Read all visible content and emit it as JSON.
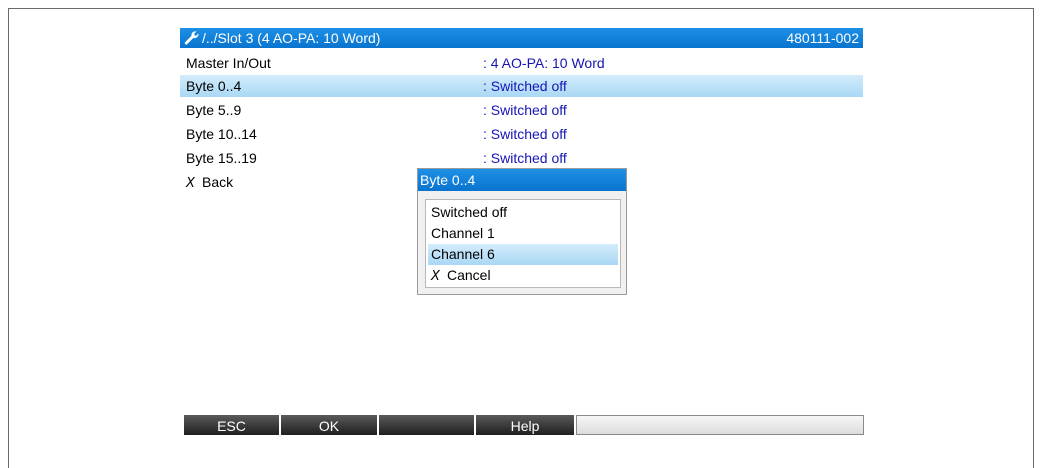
{
  "header": {
    "path": "/../Slot 3 (4 AO-PA: 10 Word)",
    "code": "480111-002",
    "icon": "wrench-icon"
  },
  "rows": [
    {
      "label": "Master In/Out",
      "value": ": 4 AO-PA: 10 Word"
    },
    {
      "label": "Byte 0..4",
      "value": ": Switched off"
    },
    {
      "label": "Byte 5..9",
      "value": ": Switched off"
    },
    {
      "label": "Byte 10..14",
      "value": ": Switched off"
    },
    {
      "label": "Byte 15..19",
      "value": ": Switched off"
    }
  ],
  "back": {
    "icon_text": "X",
    "label": "Back"
  },
  "popup": {
    "title": "Byte 0..4",
    "options": [
      "Switched off",
      "Channel 1",
      "Channel 6",
      "Cancel"
    ],
    "cancel_icon_text": "X"
  },
  "softkeys": {
    "esc": "ESC",
    "ok": "OK",
    "blank": "",
    "help": "Help"
  },
  "colors": {
    "accent": "#0a74cf",
    "selection": "#a9d8f5",
    "value_text": "#1515b5"
  }
}
